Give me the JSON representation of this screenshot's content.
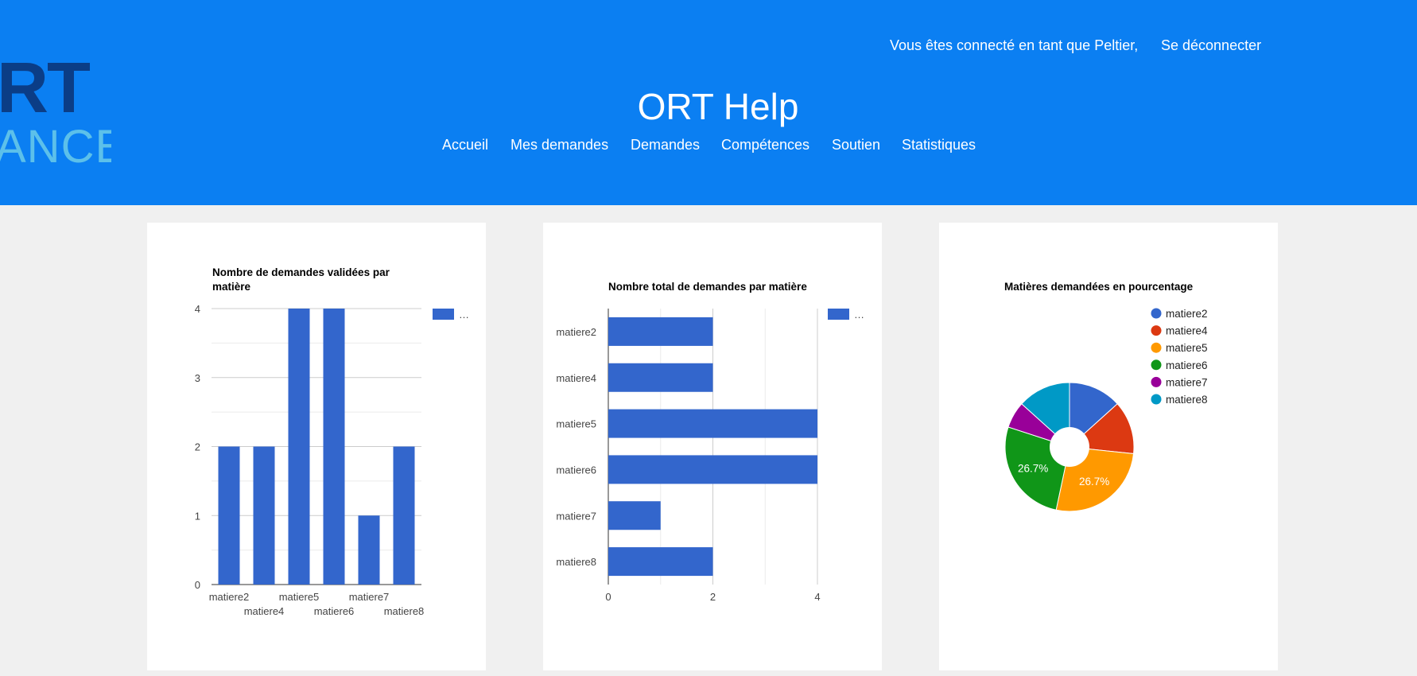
{
  "header": {
    "logo_text_top": "RT",
    "logo_text_bottom": "ANCE",
    "user_text": "Vous êtes connecté en tant que Peltier,",
    "logout_label": "Se déconnecter",
    "site_title": "ORT Help",
    "nav": [
      "Accueil",
      "Mes demandes",
      "Demandes",
      "Compétences",
      "Soutien",
      "Statistiques"
    ]
  },
  "colors": {
    "header_bg": "#0b7ff2",
    "bar": "#3366cc",
    "pie": [
      "#3366cc",
      "#dc3912",
      "#ff9900",
      "#109618",
      "#990099",
      "#0099c6"
    ]
  },
  "chart_data": [
    {
      "type": "bar",
      "title_lines": [
        "Nombre de demandes validées par",
        "matière"
      ],
      "categories": [
        "matiere2",
        "matiere4",
        "matiere5",
        "matiere6",
        "matiere7",
        "matiere8"
      ],
      "values": [
        2,
        2,
        4,
        4,
        1,
        2
      ],
      "ylim": [
        0,
        4
      ],
      "yticks": [
        "0",
        "1",
        "2",
        "3",
        "4"
      ],
      "legend": "…",
      "grid": true
    },
    {
      "type": "bar",
      "orientation": "horizontal",
      "title": "Nombre total de demandes par matière",
      "categories": [
        "matiere2",
        "matiere4",
        "matiere5",
        "matiere6",
        "matiere7",
        "matiere8"
      ],
      "values": [
        2,
        2,
        4,
        4,
        1,
        2
      ],
      "xlim": [
        0,
        4
      ],
      "xticks": [
        "0",
        "2",
        "4"
      ],
      "legend": "…",
      "grid": true
    },
    {
      "type": "pie",
      "title": "Matières demandées en pourcentage",
      "labels": [
        "matiere2",
        "matiere4",
        "matiere5",
        "matiere6",
        "matiere7",
        "matiere8"
      ],
      "values": [
        2,
        2,
        4,
        4,
        1,
        2
      ],
      "slice_labels": [
        "",
        "",
        "26.7%",
        "26.7%",
        "",
        ""
      ],
      "donut": true,
      "legend_position": "right"
    }
  ]
}
